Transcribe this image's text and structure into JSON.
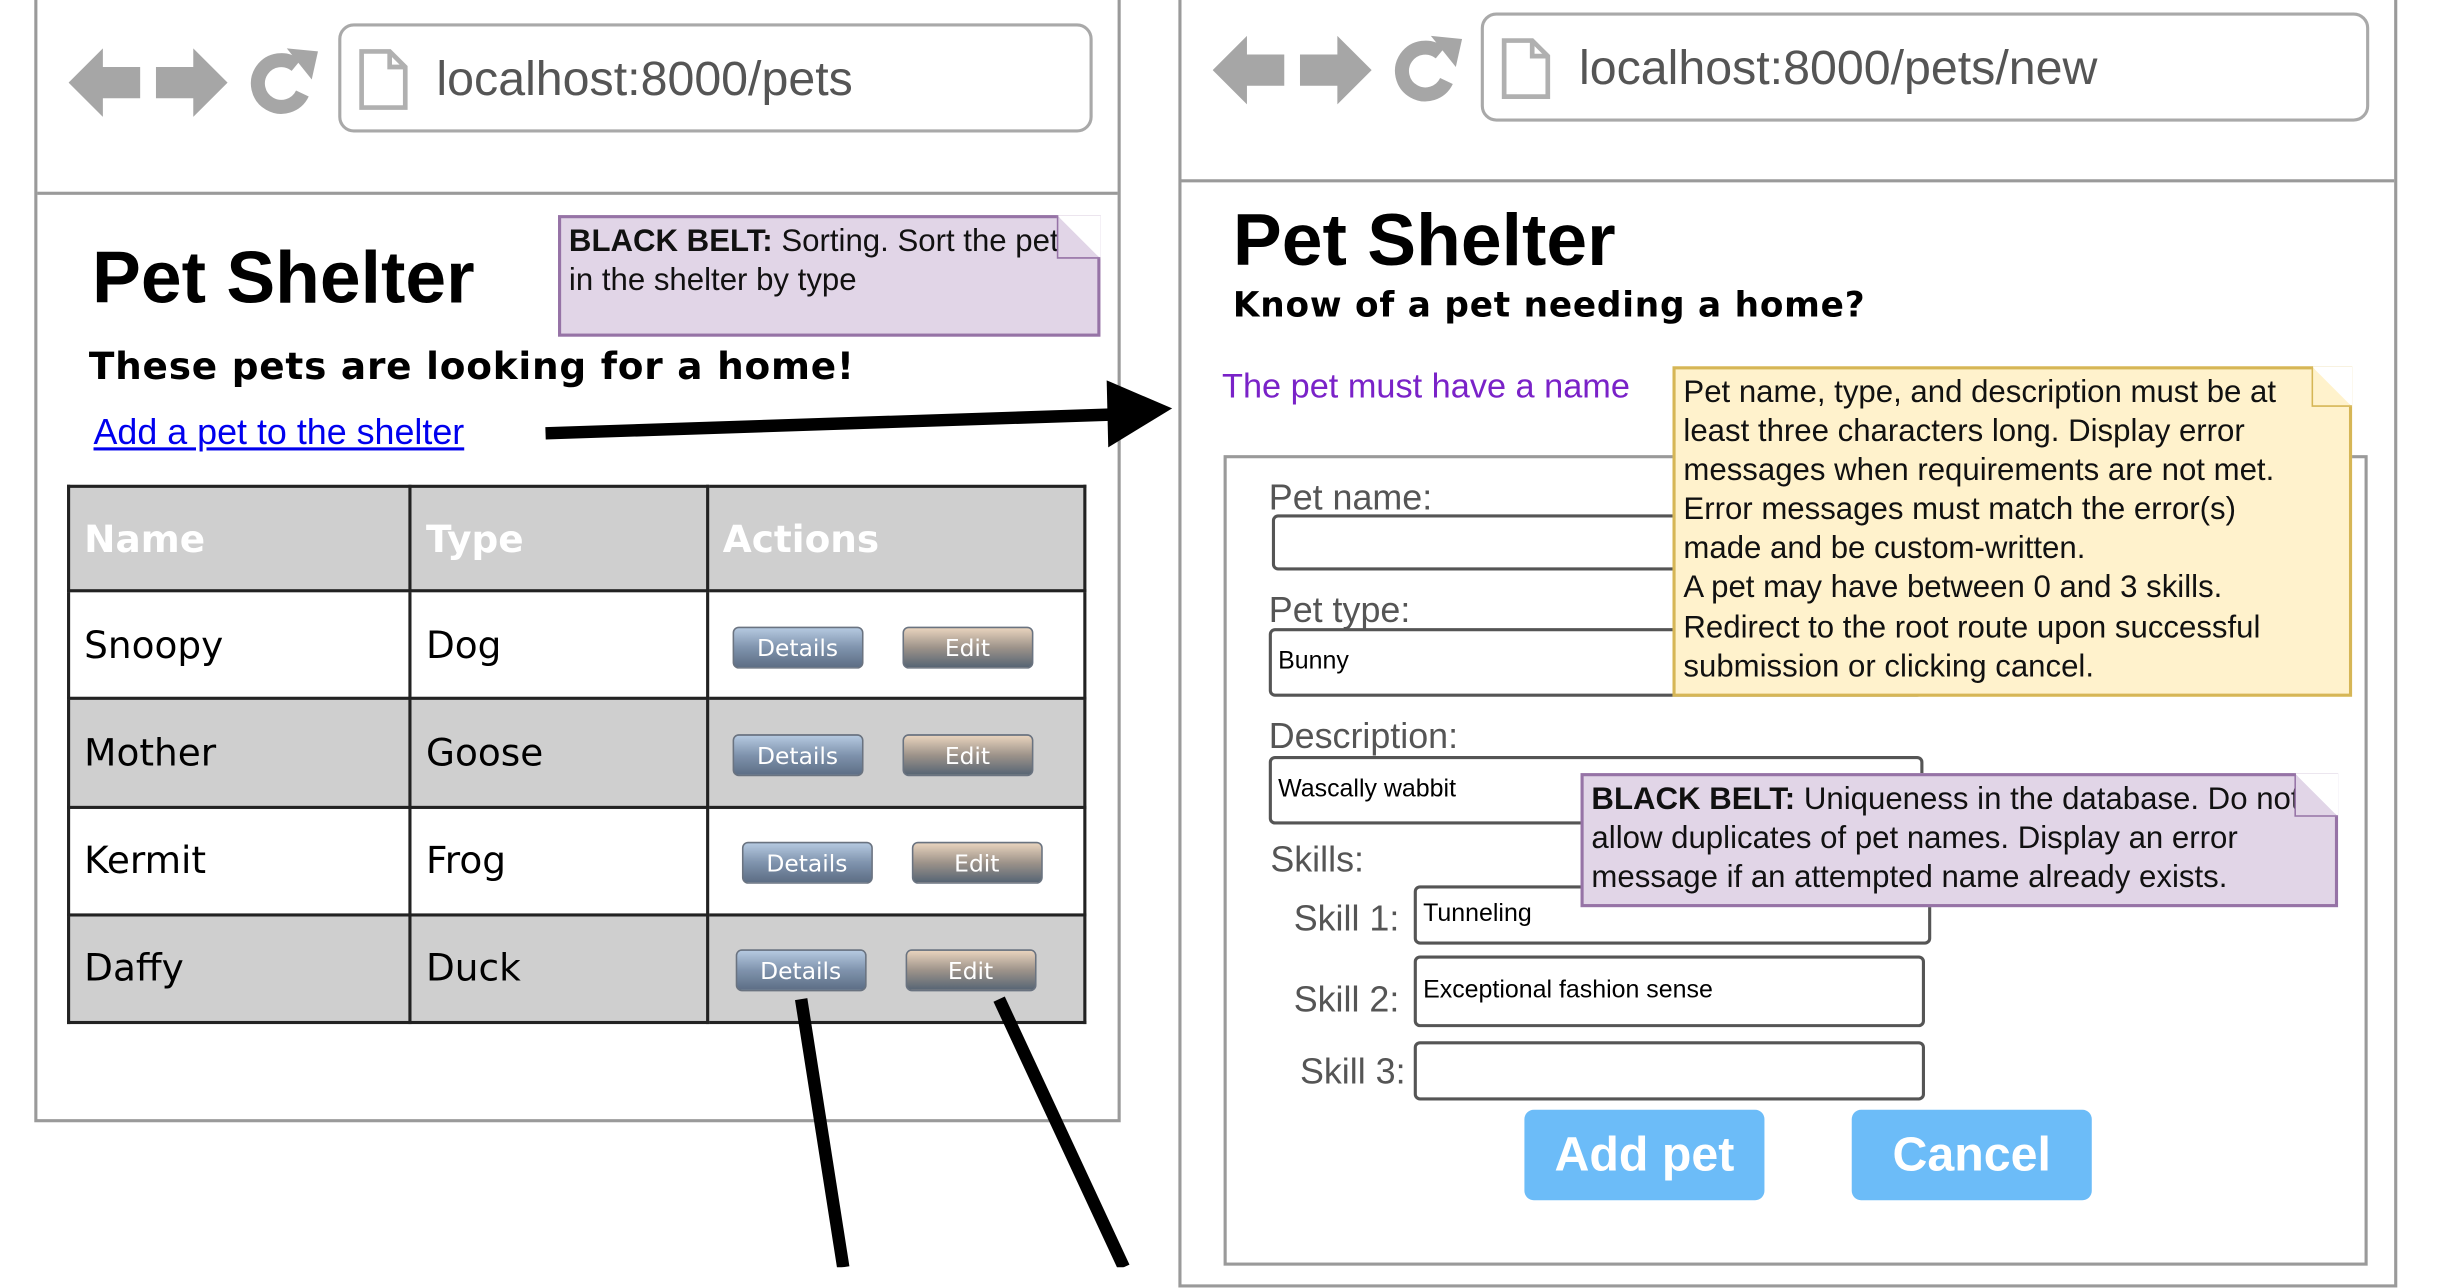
{
  "left": {
    "url": "localhost:8000/pets",
    "title": "Pet Shelter",
    "subtitle": "These pets are looking for a home!",
    "add_link": "Add a pet to the shelter",
    "table": {
      "headers": [
        "Name",
        "Type",
        "Actions"
      ],
      "rows": [
        {
          "name": "Snoopy",
          "type": "Dog"
        },
        {
          "name": "Mother",
          "type": "Goose"
        },
        {
          "name": "Kermit",
          "type": "Frog"
        },
        {
          "name": "Daffy",
          "type": "Duck"
        }
      ],
      "details_label": "Details",
      "edit_label": "Edit"
    },
    "note_sort": {
      "bold": "BLACK BELT:",
      "text": " Sorting. Sort the pets in the shelter by type"
    }
  },
  "right": {
    "url": "localhost:8000/pets/new",
    "title": "Pet Shelter",
    "subtitle": "Know of a pet needing a home?",
    "error": "The pet must have a name",
    "form": {
      "name_label": "Pet name:",
      "name_value": "",
      "type_label": "Pet type:",
      "type_value": "Bunny",
      "desc_label": "Description:",
      "desc_value": "Wascally wabbit",
      "skills_label": "Skills:",
      "skill1_label": "Skill 1:",
      "skill1_value": "Tunneling",
      "skill2_label": "Skill 2:",
      "skill2_value": "Exceptional fashion sense",
      "skill3_label": "Skill 3:",
      "skill3_value": "",
      "add_button": "Add pet",
      "cancel_button": "Cancel"
    },
    "note_rules": [
      "Pet name, type, and description must be at",
      "least three characters long. Display error",
      "messages when requirements are not met.",
      "Error messages must match the error(s)",
      "made and be custom-written.",
      "A pet may have between 0 and 3 skills.",
      "Redirect to the root route upon successful",
      "submission or clicking cancel."
    ],
    "note_unique": {
      "bold": "BLACK BELT:",
      "text": " Uniqueness in the database. Do not allow duplicates of pet names. Display an error message if an attempted name already exists."
    }
  },
  "colors": {
    "error": "#7a22c8",
    "link": "#0000ee",
    "form_button": "#6cbcf8",
    "note_purple": "#e1d5e7",
    "note_yellow": "#fff2cc"
  }
}
